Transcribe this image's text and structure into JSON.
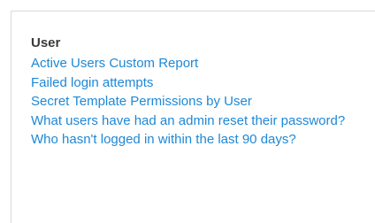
{
  "section": {
    "title": "User",
    "links": [
      {
        "label": "Active Users Custom Report"
      },
      {
        "label": "Failed login attempts"
      },
      {
        "label": "Secret Template Permissions by User"
      },
      {
        "label": "What users have had an admin reset their password?"
      },
      {
        "label": "Who hasn't logged in within the last 90 days?"
      }
    ]
  },
  "colors": {
    "link": "#1e88d6",
    "title": "#3a3a3a",
    "border": "#d9d9d9"
  }
}
